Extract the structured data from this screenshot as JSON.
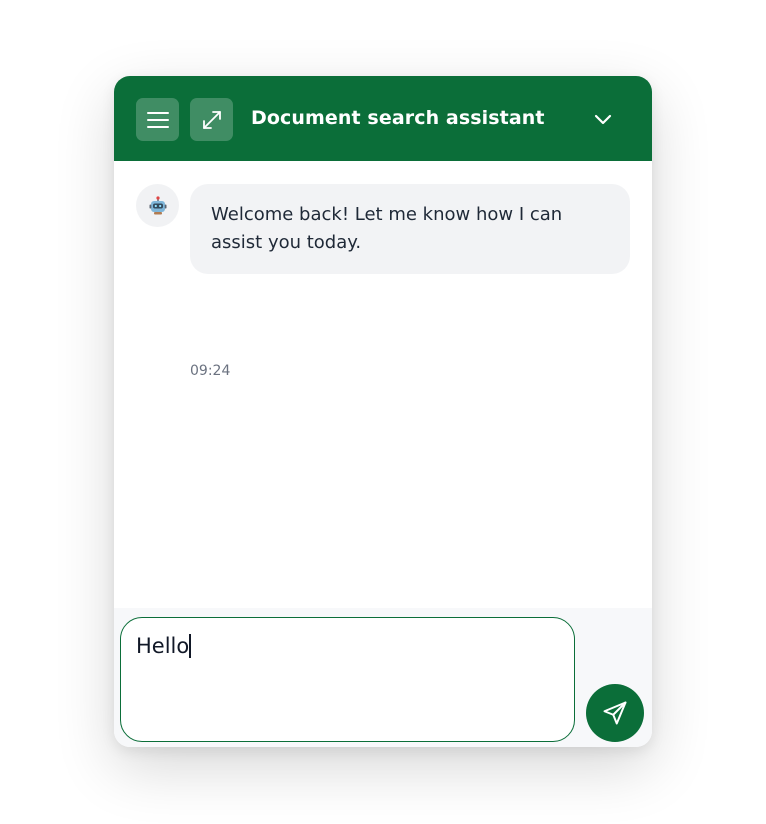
{
  "header": {
    "title": "Document search assistant",
    "menu_icon": "menu-icon",
    "expand_icon": "expand-icon",
    "collapse_icon": "chevron-down-icon"
  },
  "messages": [
    {
      "sender": "bot",
      "avatar_icon": "robot-icon",
      "text": "Welcome back! Let me know how I can assist you today.",
      "time": "09:24"
    }
  ],
  "composer": {
    "value": "Hello",
    "send_icon": "send-icon"
  },
  "colors": {
    "brand": "#0b6e39",
    "bubble": "#f2f3f5",
    "composer_bg": "#f7f8fa"
  }
}
